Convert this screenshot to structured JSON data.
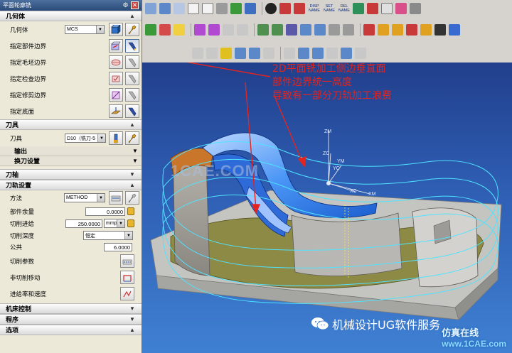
{
  "dialog": {
    "title": "平面轮廓铣",
    "close_glyph": "✕",
    "gear_glyph": "⚙",
    "geometry": {
      "header": "几何体",
      "geometry_label": "几何体",
      "geometry_value": "MCS",
      "part_boundary_label": "指定部件边界",
      "blank_boundary_label": "指定毛坯边界",
      "check_boundary_label": "指定检查边界",
      "trim_boundary_label": "指定修剪边界",
      "floor_label": "指定底面"
    },
    "tool": {
      "header": "刀具",
      "tool_label": "刀具",
      "tool_value": "D10（铣刀-5",
      "output_label": "输出",
      "tool_change_label": "换刀设置"
    },
    "tool_axis": {
      "header": "刀轴"
    },
    "path_settings": {
      "header": "刀轨设置",
      "method_label": "方法",
      "method_value": "METHOD",
      "part_stock_label": "部件余量",
      "part_stock_value": "0.0000",
      "feed_label": "切削进给",
      "feed_value": "250.0000",
      "feed_unit": "mmpm",
      "depth_label": "切削深度",
      "depth_value": "恒定",
      "common_label": "公共",
      "common_value": "6.0000",
      "cut_params_label": "切削参数",
      "non_cut_label": "非切削移动",
      "feeds_speeds_label": "进给率和速度"
    },
    "machine_control": {
      "header": "机床控制"
    },
    "program": {
      "header": "程序"
    },
    "options": {
      "header": "选项"
    }
  },
  "toolbar": {
    "disp_name": "DISP\nNAME",
    "set_name": "SET\nNAME",
    "del_name": "DEL\nNAME"
  },
  "viewport": {
    "annotation": {
      "line1": "2D平面铣加工侧边垂直面",
      "line2": "部件边界统一高度",
      "line3": "导致有一部分刀轨加工浪费"
    },
    "watermark": "1CAE.COM",
    "axes": {
      "zm": "ZM",
      "zc": "ZC",
      "ym": "YM",
      "yc": "YC",
      "xc": "XC",
      "xm": "XM"
    },
    "brand_text": "机械设计UG软件服务",
    "corner_logo_top": "仿真在线",
    "corner_logo_bottom": "www.1CAE.com"
  },
  "colors": {
    "annotation": "#e3241f",
    "viewport_top": "#213f8c",
    "viewport_bottom": "#3f80d2",
    "toolpath": "#4fe3ff",
    "base": "#bcbcb8",
    "wall": "#8f8c88",
    "floor": "#8b8540",
    "cavity": "#2f7ff0",
    "orange": "#c9752a"
  }
}
